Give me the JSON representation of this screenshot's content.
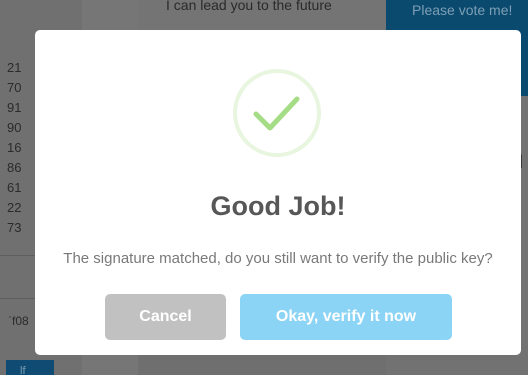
{
  "background": {
    "quote_text": "I can lead you to the future",
    "vote_button_label": "Please vote me!",
    "list_values": [
      "21",
      "70",
      "91",
      "90",
      "16",
      "86",
      "61",
      "22",
      "73"
    ],
    "code_fragment": "ˈf08",
    "right_glyph": "ll",
    "bottom_button_label": "lf"
  },
  "modal": {
    "title": "Good Job!",
    "message": "The signature matched, do you still want to verify the public key?",
    "cancel_label": "Cancel",
    "confirm_label": "Okay, verify it now",
    "icon": "checkmark-icon"
  },
  "colors": {
    "overlay": "#6f6f6f",
    "success_green": "#a5dc86",
    "cancel_button": "#c1c1c1",
    "confirm_button": "#8cd4f5",
    "title_text": "#575757",
    "message_text": "#797979"
  }
}
